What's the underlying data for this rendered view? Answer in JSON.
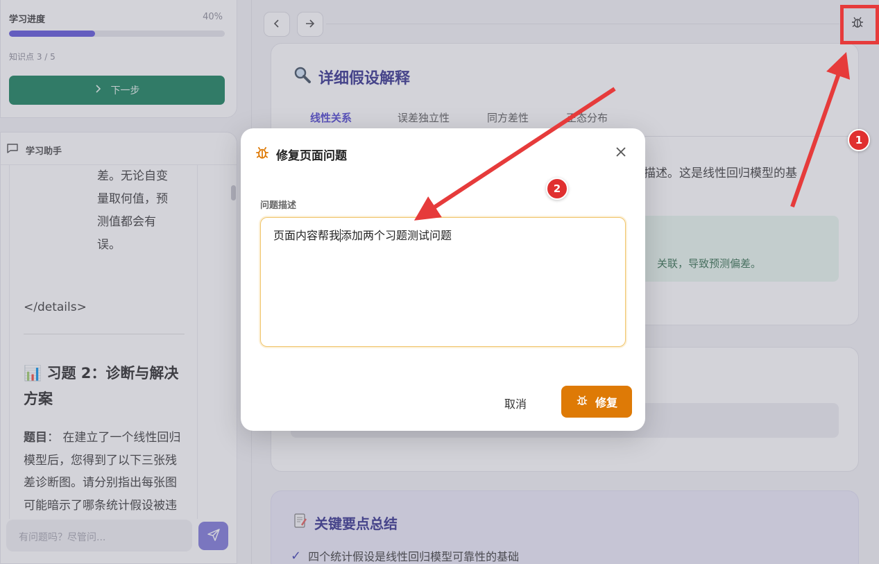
{
  "sidebar": {
    "progress": {
      "title": "学习进度",
      "percent_label": "40%",
      "percent": 0.4,
      "sub": "知识点 3 / 5",
      "next_label": "下一步"
    },
    "assistant": {
      "title": "学习助手",
      "frag_lines": [
        "差。无论自变",
        "量取何值，预",
        "测值都会有",
        "误。"
      ],
      "details_tag": "</details>",
      "question_title": "📊 习题 2：诊断与解决方案",
      "question_label": "题目",
      "question_body": "： 在建立了一个线性回归模型后，您得到了以下三张残差诊断图。请分别指出每张图可能暗示了哪条统计假设被违反，并提出一种可",
      "input_placeholder": "有问题吗？尽管问..."
    }
  },
  "main": {
    "card_title": "详细假设解释",
    "tabs": [
      "线性关系",
      "误差独立性",
      "同方差性",
      "正态分布"
    ],
    "card_text": "以描述。这是线性回归模型的基",
    "green_text": "关联，导致预测偏差。",
    "summary_title": "关键要点总结",
    "summary_item": "四个统计假设是线性回归模型可靠性的基础"
  },
  "modal": {
    "title": "修复页面问题",
    "field_label": "问题描述",
    "text_before_caret": "页面内容帮我",
    "text_after_caret": "添加两个习题测试问题",
    "cancel_label": "取消",
    "fix_label": "修复"
  },
  "annotations": {
    "badge_1": "1",
    "badge_2": "2"
  },
  "colors": {
    "accent": "#4a3fd0",
    "progress": "#5a4fd8",
    "next_button": "#0e7c55",
    "fix_button": "#de7a06",
    "annotation_red": "#e63b3b"
  }
}
